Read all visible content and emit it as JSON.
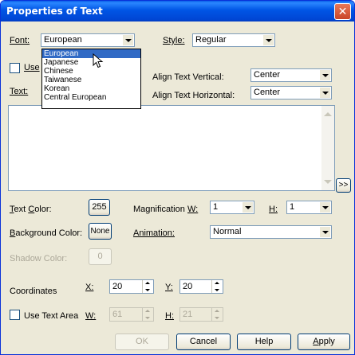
{
  "window": {
    "title": "Properties of Text",
    "close_glyph": "✕"
  },
  "font": {
    "label": "Font:",
    "value": "European",
    "options": [
      "European",
      "Japanese",
      "Chinese",
      "Taiwanese",
      "Korean",
      "Central European"
    ]
  },
  "style": {
    "label": "Style:",
    "value": "Regular"
  },
  "use_checkbox_label": "Use",
  "text_label": "Text:",
  "align_vertical": {
    "label": "Align Text Vertical:",
    "value": "Center"
  },
  "align_horizontal": {
    "label": "Align Text Horizontal:",
    "value": "Center"
  },
  "expand_button": ">>",
  "text_color": {
    "label": "Text Color:",
    "value": "255"
  },
  "background_color": {
    "label": "Background Color:",
    "value": "None"
  },
  "shadow_color": {
    "label": "Shadow Color:",
    "value": "0"
  },
  "magnification": {
    "label": "Magnification",
    "w_label": "W:",
    "w_value": "1",
    "h_label": "H:",
    "h_value": "1"
  },
  "animation": {
    "label": "Animation:",
    "value": "Normal"
  },
  "coordinates": {
    "label": "Coordinates",
    "x_label": "X:",
    "x_value": "20",
    "y_label": "Y:",
    "y_value": "20"
  },
  "text_area": {
    "label": "Use Text Area",
    "w_label": "W:",
    "w_value": "61",
    "h_label": "H:",
    "h_value": "21"
  },
  "buttons": {
    "ok": "OK",
    "cancel": "Cancel",
    "help": "Help",
    "apply": "Apply"
  },
  "colors": {
    "titlebar": "#0055e5",
    "dialog_bg": "#ece9d8",
    "selection": "#316ac5"
  }
}
